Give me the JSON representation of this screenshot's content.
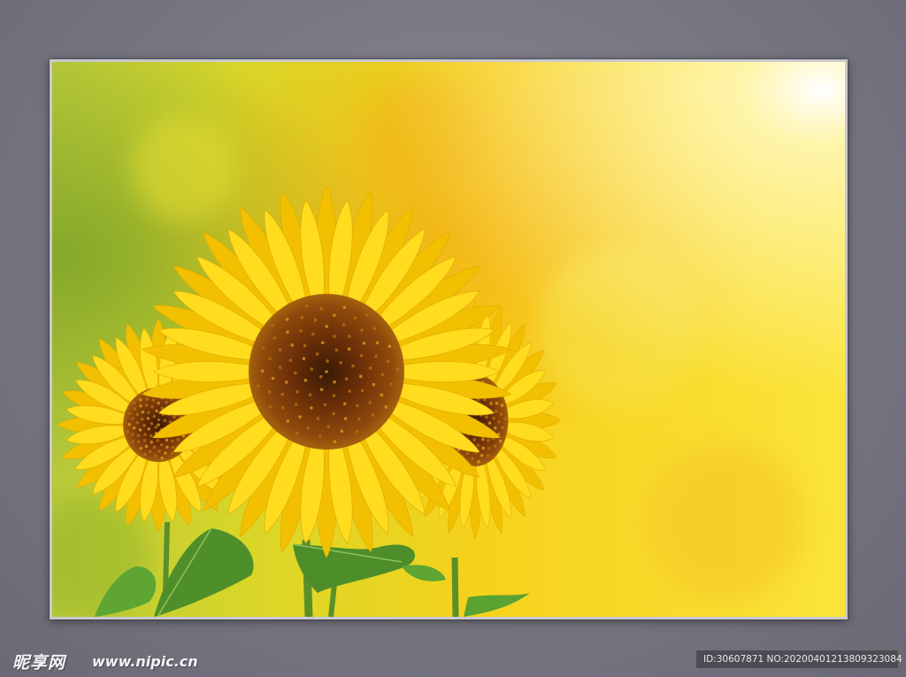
{
  "photo": {
    "subject": "sunflowers",
    "palette": {
      "sky": "#f5e21a",
      "glow": "#fff8c8",
      "petal": "#f7d40a",
      "center": "#7a3a08",
      "leaf": "#4f9a2a"
    }
  },
  "watermark": {
    "logo_text": "昵享网",
    "site_text": "www.nipic.cn",
    "id_text": "ID:30607871 NO:20200401213809323084"
  }
}
